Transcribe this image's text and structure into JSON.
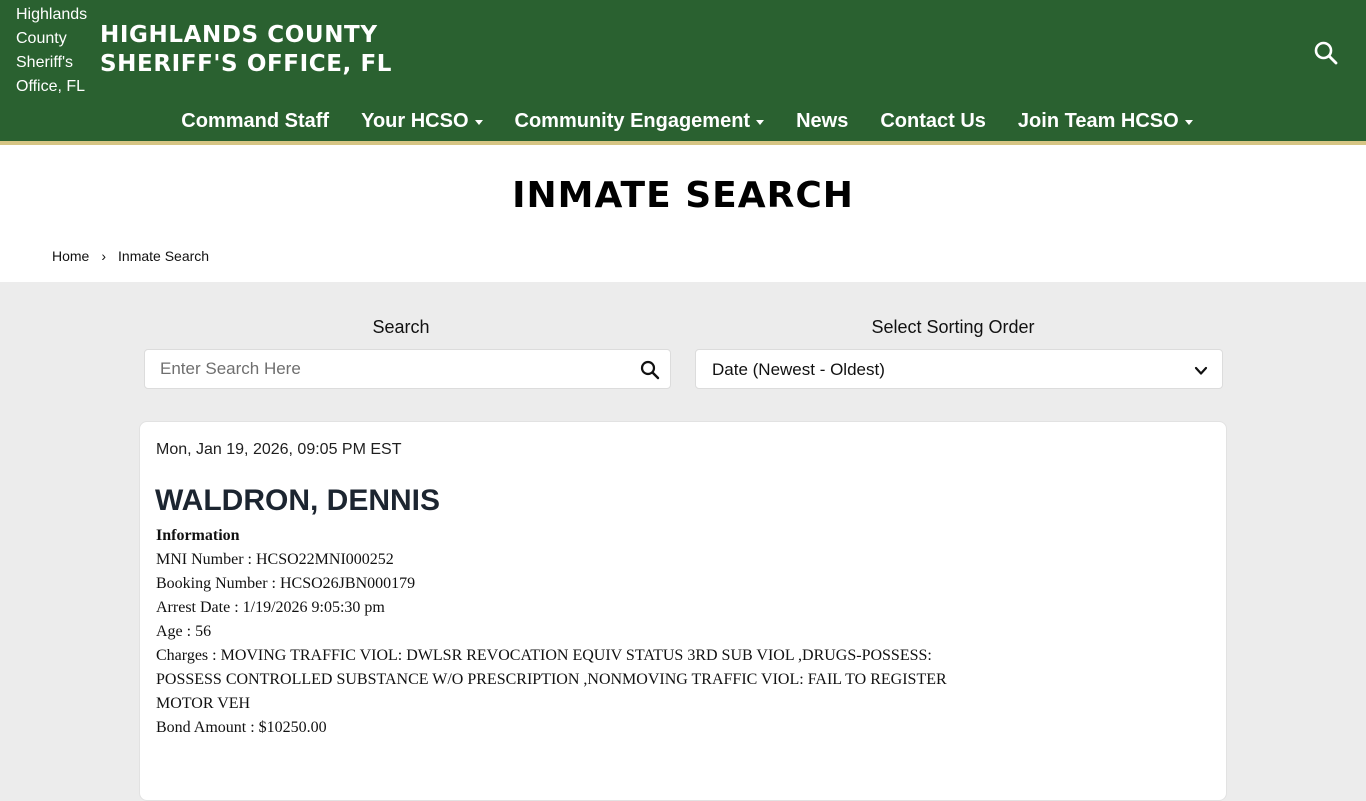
{
  "header": {
    "logo_alt": "Highlands County Sheriff's Office, FL",
    "site_title_line1": "HIGHLANDS COUNTY",
    "site_title_line2": "SHERIFF'S OFFICE, FL",
    "search_icon": "search-icon"
  },
  "nav": {
    "items": [
      {
        "label": "Command Staff",
        "dropdown": false
      },
      {
        "label": "Your HCSO",
        "dropdown": true
      },
      {
        "label": "Community Engagement",
        "dropdown": true
      },
      {
        "label": "News",
        "dropdown": false
      },
      {
        "label": "Contact Us",
        "dropdown": false
      },
      {
        "label": "Join Team HCSO",
        "dropdown": true
      }
    ]
  },
  "page": {
    "title": "INMATE SEARCH",
    "breadcrumb": {
      "home": "Home",
      "separator": "›",
      "current": "Inmate Search"
    }
  },
  "filters": {
    "search_label": "Search",
    "search_placeholder": "Enter Search Here",
    "search_value": "",
    "sort_label": "Select Sorting Order",
    "sort_selected": "Date (Newest - Oldest)"
  },
  "record": {
    "timestamp": "Mon, Jan 19, 2026, 09:05 PM EST",
    "name": "WALDRON, DENNIS",
    "info_heading": "Information",
    "mni_number": "MNI Number : HCSO22MNI000252",
    "booking_number": "Booking Number : HCSO26JBN000179",
    "arrest_date": "Arrest Date : 1/19/2026 9:05:30 pm",
    "age": "Age : 56",
    "charges_line1": "Charges : MOVING TRAFFIC VIOL: DWLSR REVOCATION EQUIV STATUS 3RD SUB VIOL ,DRUGS-POSSESS:",
    "charges_line2": "POSSESS CONTROLLED SUBSTANCE W/O PRESCRIPTION ,NONMOVING TRAFFIC VIOL: FAIL TO REGISTER",
    "charges_line3": "MOTOR VEH",
    "bond_amount": "Bond Amount : $10250.00"
  },
  "colors": {
    "header_green": "#2a6130",
    "accent_gold": "#d6c584",
    "page_bg": "#ececec"
  }
}
